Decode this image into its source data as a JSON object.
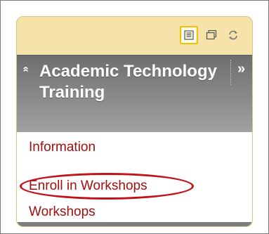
{
  "toolbar": {
    "buttons": [
      {
        "icon": "list-view-icon",
        "active": true
      },
      {
        "icon": "window-icon",
        "active": false
      },
      {
        "icon": "refresh-icon",
        "active": false
      }
    ]
  },
  "header": {
    "collapse_glyph": "»",
    "title": "Academic Technology Training",
    "expand_glyph": "»"
  },
  "menu": {
    "items": [
      {
        "label": "Information"
      },
      {
        "label": "Enroll in Workshops",
        "highlighted": true
      },
      {
        "label": "Workshops"
      }
    ]
  },
  "colors": {
    "panel_background": "#f5e3a9",
    "header_gradient_top": "#6e6e6e",
    "link_color": "#a01010",
    "highlight_ring": "#c0121c",
    "active_button_border": "#f2c200"
  }
}
